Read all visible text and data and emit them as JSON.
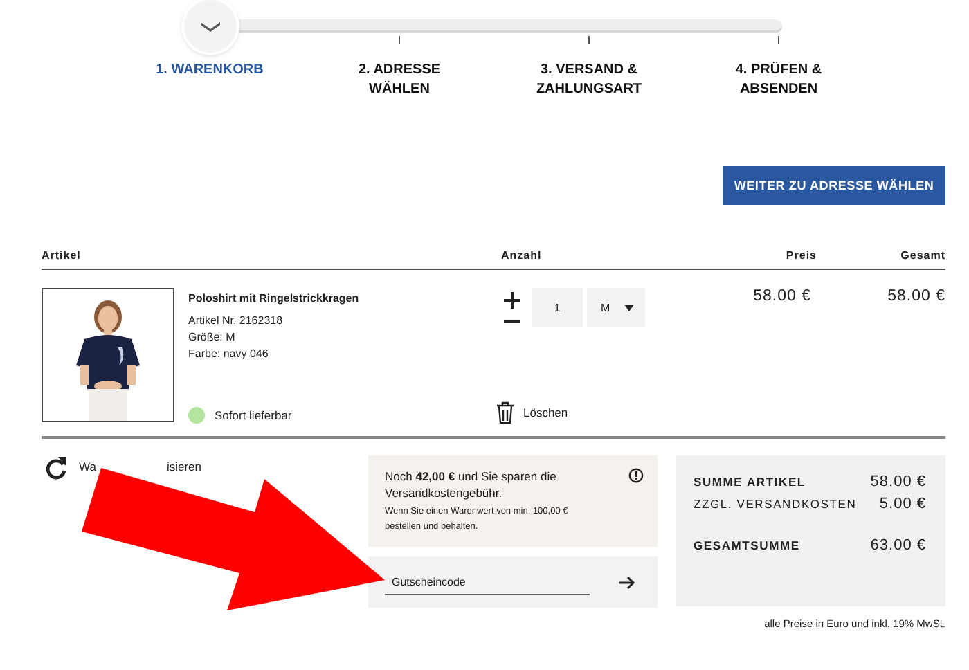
{
  "progress_steps": [
    {
      "label": "1. WARENKORB",
      "selected": true
    },
    {
      "label": "2. ADRESSE WÄHLEN",
      "selected": false
    },
    {
      "label": "3. VERSAND & ZAHLUNGSART",
      "selected": false
    },
    {
      "label": "4. PRÜFEN & ABSENDEN",
      "selected": false
    }
  ],
  "next_button": "WEITER ZU ADRESSE WÄHLEN",
  "table": {
    "columns": [
      "Artikel",
      "Anzahl",
      "Preis",
      "Gesamt"
    ],
    "rows": [
      {
        "image": {
          "kind": "picture"
        },
        "title": "Poloshirt mit Ringelstrickkragen",
        "details": [
          "Artikel Nr. 2162318",
          "Größe: M",
          "Farbe: navy 046"
        ],
        "availability": {
          "text": "Sofort lieferbar",
          "color": "#b5e3a0"
        },
        "quantity": "1",
        "size": "M",
        "delete": "Löschen",
        "price": "58.00 €",
        "total": "58.00 €"
      }
    ]
  },
  "update_cart_parts": [
    "Wa",
    "isieren"
  ],
  "shipping_notice": {
    "text": "Noch **42,00 €** und Sie sparen die Versandkostengebühr.",
    "detail": "Wenn Sie einen Warenwert von min. 100,00 € bestellen und behalten."
  },
  "voucher": {
    "placeholder": "Gutscheincode"
  },
  "summary": [
    {
      "label": "SUMME ARTIKEL",
      "value": "58.00 €",
      "kind": "bold"
    },
    {
      "label": "ZZGL. VERSANDKOSTEN",
      "value": "5.00 €",
      "kind": "plain"
    },
    {
      "label": "GESAMTSUMME",
      "value": "63.00 €",
      "kind": "total"
    }
  ],
  "footnote": "alle Preise in Euro und inkl. 19% MwSt."
}
